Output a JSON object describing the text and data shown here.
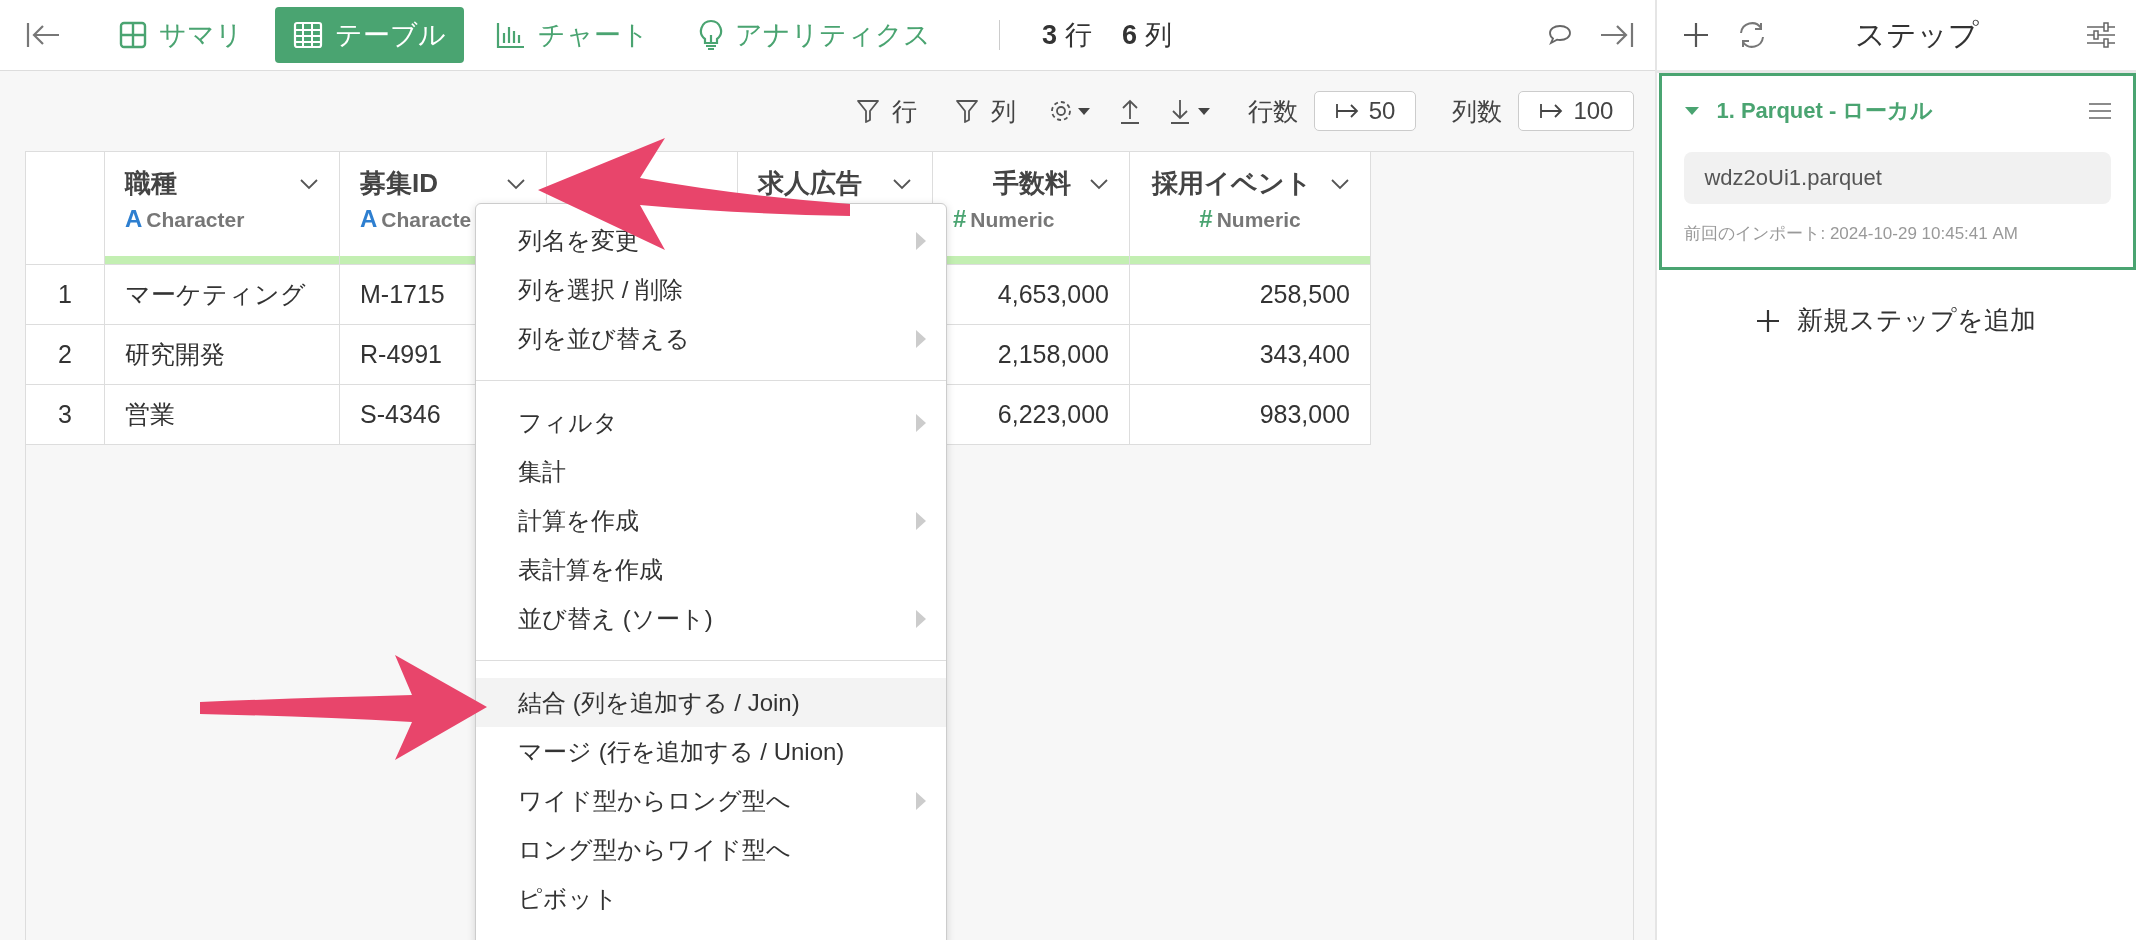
{
  "view_tabs": [
    {
      "label": "サマリ",
      "selected": false
    },
    {
      "label": "テーブル",
      "selected": true
    },
    {
      "label": "チャート",
      "selected": false
    },
    {
      "label": "アナリティクス",
      "selected": false
    }
  ],
  "counts": [
    {
      "number": "3",
      "unit": "行"
    },
    {
      "number": "6",
      "unit": "列"
    }
  ],
  "toolbar": {
    "row_filter": "行",
    "column_filter": "列",
    "row_limit_label": "行数",
    "row_limit": "50",
    "column_limit_label": "列数",
    "column_limit": "100"
  },
  "table": {
    "columns": [
      {
        "name": "職種",
        "type_icon": "A",
        "type": "Character",
        "kind": "text",
        "cells": [
          "マーケティング",
          "研究開発",
          "営業"
        ]
      },
      {
        "name": "募集ID",
        "type_icon": "A",
        "type": "Characte",
        "kind": "text",
        "cells": [
          "M-1715",
          "R-4991",
          "S-4346"
        ]
      },
      {
        "kind": "text"
      },
      {
        "name": "求人広告",
        "kind": "text"
      },
      {
        "name": "手数料",
        "type_icon": "#",
        "type": "Numeric",
        "kind": "number",
        "cells": [
          "4,653,000",
          "2,158,000",
          "6,223,000"
        ]
      },
      {
        "name": "採用イベント",
        "type_icon": "#",
        "type": "Numeric",
        "kind": "number",
        "cells": [
          "258,500",
          "343,400",
          "983,000"
        ]
      }
    ],
    "row_numbers": [
      "1",
      "2",
      "3"
    ]
  },
  "context_menu": {
    "groups": [
      [
        {
          "label": "列名を変更",
          "submenu": true,
          "selected": false
        },
        {
          "label": "列を選択 / 削除",
          "submenu": false,
          "selected": false
        },
        {
          "label": "列を並び替える",
          "submenu": true,
          "selected": false
        }
      ],
      [
        {
          "label": "フィルタ",
          "submenu": true,
          "selected": false
        },
        {
          "label": "集計",
          "submenu": false,
          "selected": false
        },
        {
          "label": "計算を作成",
          "submenu": true,
          "selected": false
        },
        {
          "label": "表計算を作成",
          "submenu": false,
          "selected": false
        },
        {
          "label": "並び替え (ソート)",
          "submenu": true,
          "selected": false
        }
      ],
      [
        {
          "label": "結合 (列を追加する / Join)",
          "submenu": false,
          "selected": true
        },
        {
          "label": "マージ (行を追加する / Union)",
          "submenu": false,
          "selected": false
        },
        {
          "label": "ワイド型からロング型へ",
          "submenu": true,
          "selected": false
        },
        {
          "label": "ロング型からワイド型へ",
          "submenu": false,
          "selected": false
        },
        {
          "label": "ピボット",
          "submenu": false,
          "selected": false
        }
      ]
    ]
  },
  "steps_panel": {
    "title": "ステップ",
    "steps": [
      {
        "title": "1. Parquet - ローカル",
        "expanded": true,
        "selected": true,
        "file": "wdz2oUi1.parquet",
        "imported": "前回のインポート: 2024-10-29 10:45:41 AM"
      }
    ],
    "add_step": "新規ステップを追加"
  }
}
